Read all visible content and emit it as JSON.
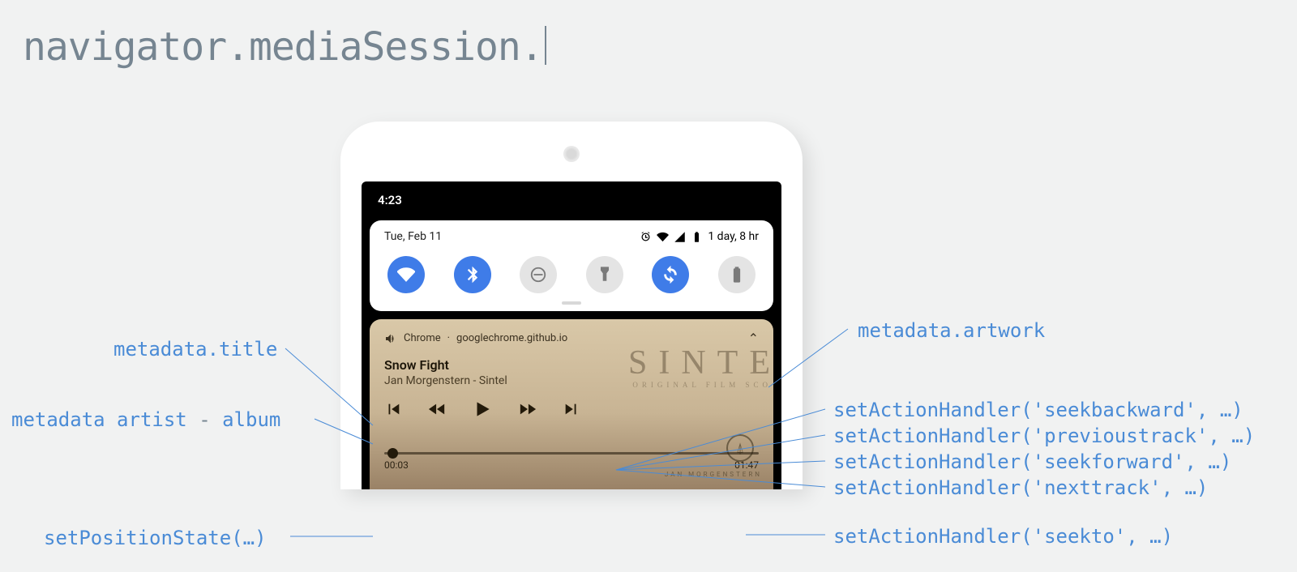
{
  "header": {
    "code": "navigator.mediaSession."
  },
  "phone": {
    "clock": "4:23",
    "qs": {
      "date": "Tue, Feb 11",
      "battery_text": "1 day, 8 hr",
      "toggles": [
        {
          "name": "wifi",
          "active": true
        },
        {
          "name": "bluetooth",
          "active": true
        },
        {
          "name": "dnd",
          "active": false
        },
        {
          "name": "flashlight",
          "active": false
        },
        {
          "name": "autorotate",
          "active": true
        },
        {
          "name": "battery-saver",
          "active": false
        }
      ]
    },
    "media": {
      "app": "Chrome",
      "origin": "googlechrome.github.io",
      "separator": " · ",
      "title": "Snow Fight",
      "artist_album": "Jan Morgenstern - Sintel",
      "elapsed": "00:03",
      "duration": "01:47",
      "ghost_title": "ORIGINAL FILM SCO",
      "ghost_credit": "JAN MORGENSTERN"
    }
  },
  "labels": {
    "left": {
      "title": "metadata.title",
      "artist_prefix": "metadata artist",
      "artist_middle": " - ",
      "artist_suffix": "album",
      "position": "setPositionState(…)"
    },
    "right": {
      "artwork": "metadata.artwork",
      "seekbackward": "setActionHandler('seekbackward', …)",
      "previoustrack": "setActionHandler('previoustrack', …)",
      "seekforward": "setActionHandler('seekforward', …)",
      "nexttrack": "setActionHandler('nexttrack', …)",
      "seekto": "setActionHandler('seekto', …)"
    }
  }
}
